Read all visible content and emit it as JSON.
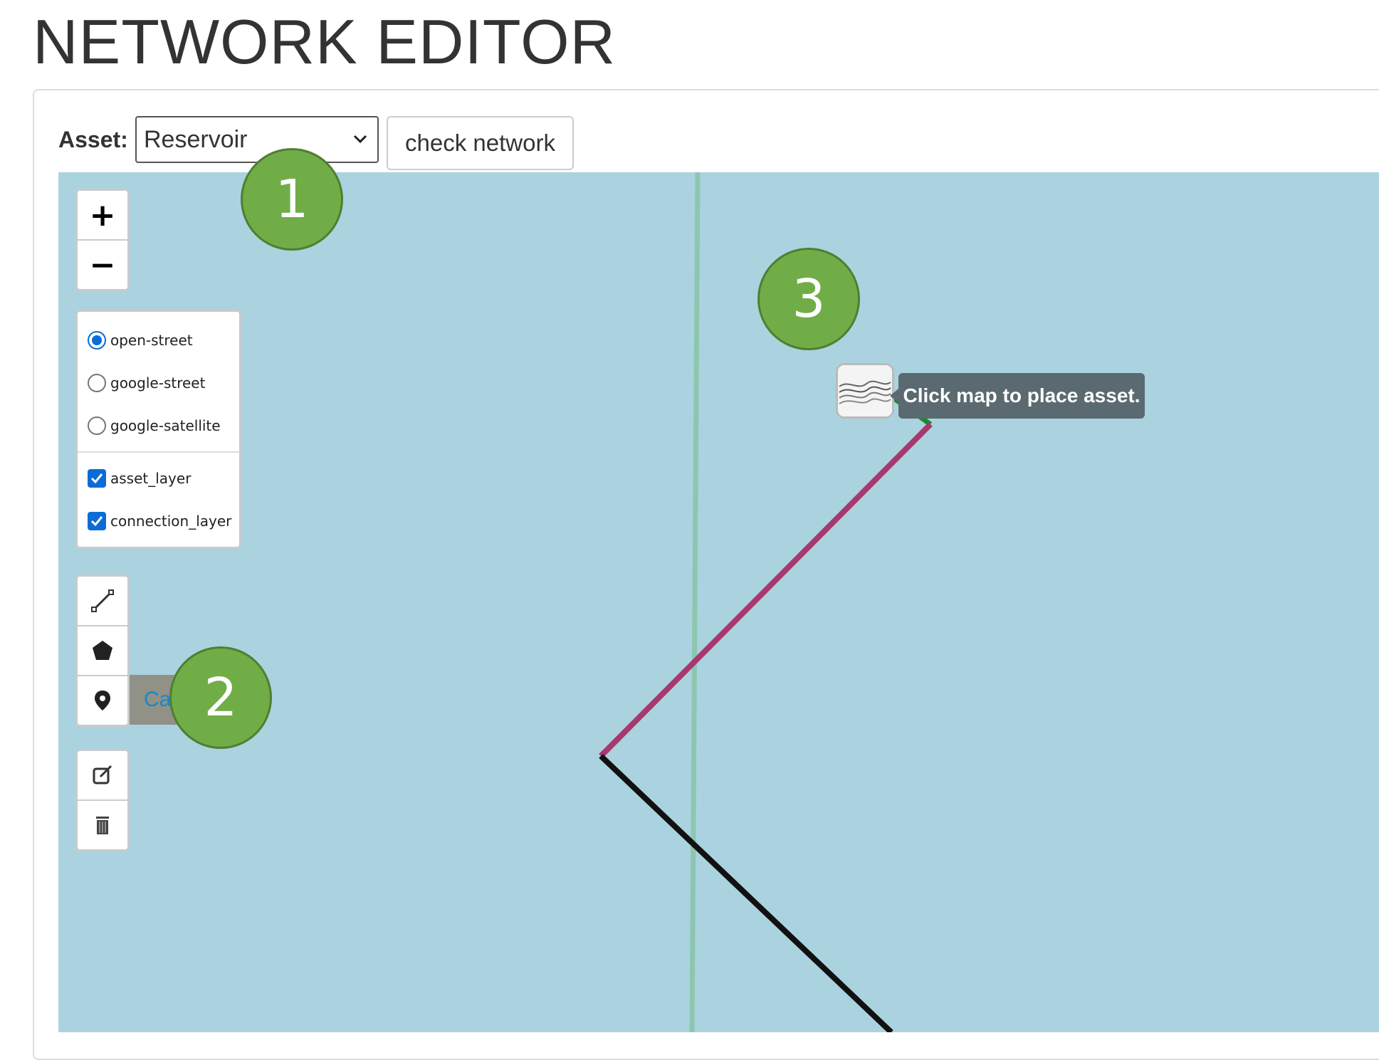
{
  "page": {
    "title": "NETWORK EDITOR"
  },
  "toolbar": {
    "asset_label": "Asset:",
    "asset_selected": "Reservoir",
    "check_button": "check network"
  },
  "map": {
    "zoom": {
      "in_label": "+",
      "out_label": "−"
    },
    "base_layers": [
      {
        "label": "open-street",
        "selected": true
      },
      {
        "label": "google-street",
        "selected": false
      },
      {
        "label": "google-satellite",
        "selected": false
      }
    ],
    "overlays": [
      {
        "label": "asset_layer",
        "checked": true
      },
      {
        "label": "connection_layer",
        "checked": true
      }
    ],
    "draw_tools": [
      "polyline-icon",
      "polygon-icon",
      "marker-icon"
    ],
    "edit_tools": [
      "edit-icon",
      "trash-icon"
    ],
    "cancel_label": "Cancel",
    "tooltip": "Click map to place asset.",
    "colors": {
      "water": "#aad3df",
      "pipe_magenta": "#a8386e",
      "pipe_black": "#111111",
      "pipe_green": "#1a8a2a",
      "river": "#8cc6b0"
    }
  },
  "annotations": [
    "1",
    "2",
    "3"
  ]
}
